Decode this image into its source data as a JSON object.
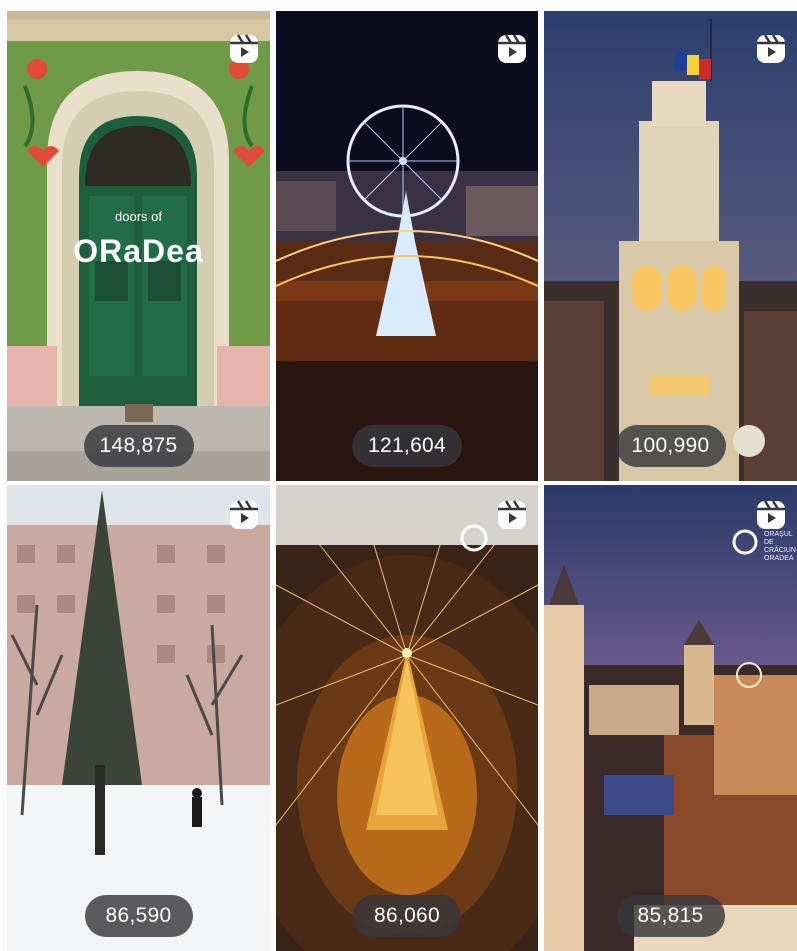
{
  "grid": {
    "tiles": [
      {
        "views": "148,875",
        "caption_small": "doors of",
        "caption_big": "ORaDea",
        "icon": "reels-icon"
      },
      {
        "views": "121,604",
        "icon": "reels-icon"
      },
      {
        "views": "100,990",
        "icon": "reels-icon"
      },
      {
        "views": "86,590",
        "icon": "reels-icon"
      },
      {
        "views": "86,060",
        "icon": "reels-icon"
      },
      {
        "views": "85,815",
        "icon": "reels-icon",
        "watermark": [
          "ORAȘUL DE",
          "CRĂCIUN",
          "ORADEA"
        ]
      }
    ]
  },
  "colors": {
    "pill_bg": "#37373c",
    "pill_text": "#ffffff",
    "door_green": "#1f6b45",
    "wall_green": "#7a9a4a"
  }
}
